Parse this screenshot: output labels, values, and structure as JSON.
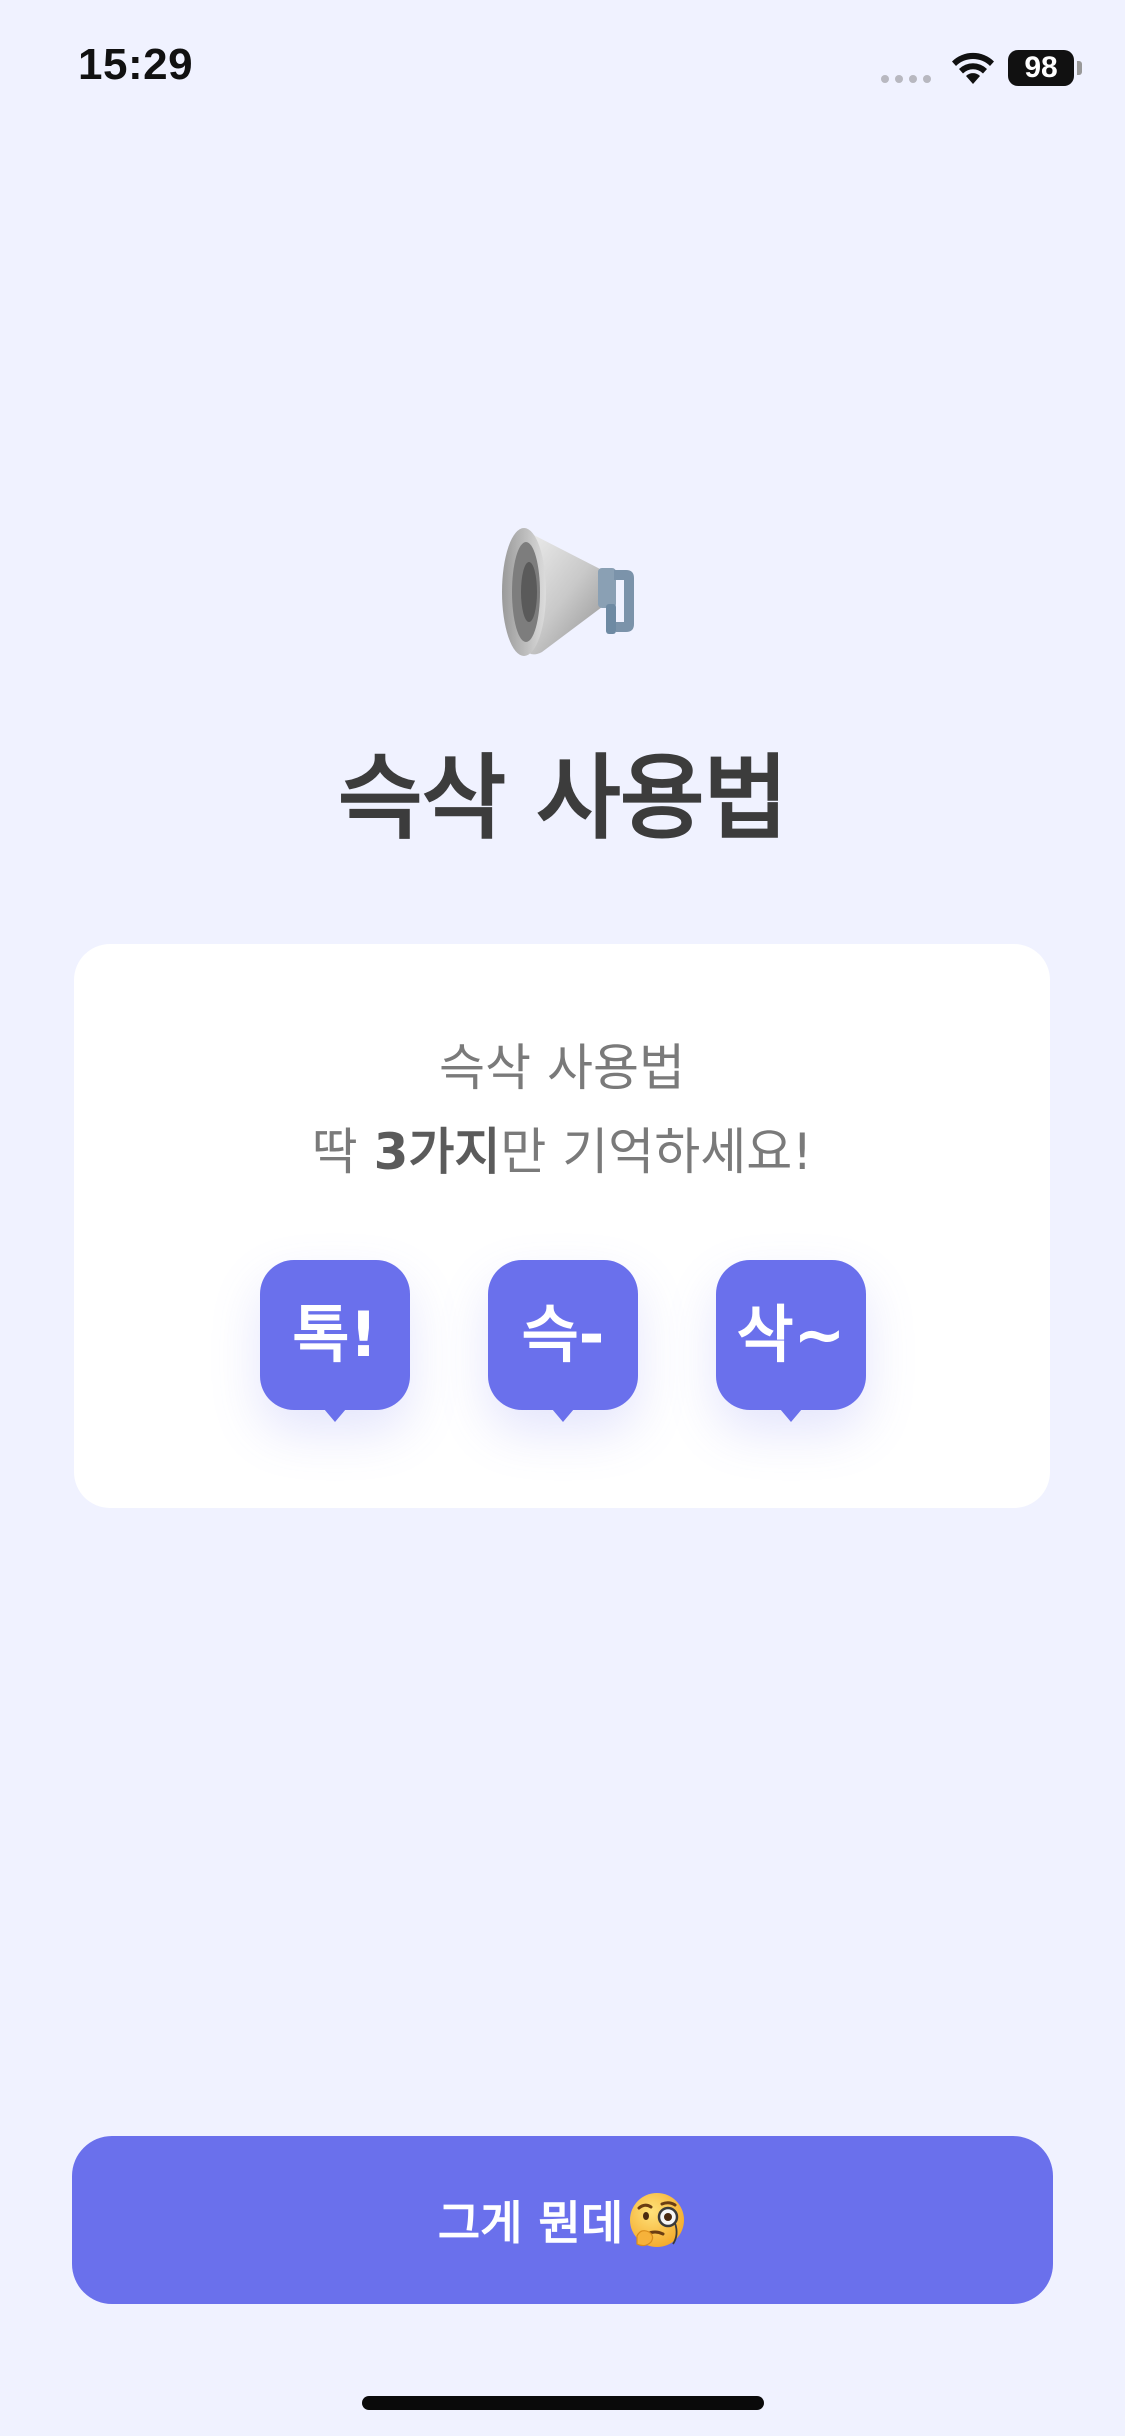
{
  "status_bar": {
    "time": "15:29",
    "battery": "98"
  },
  "hero": {
    "icon": "megaphone-icon",
    "title": "슥삭 사용법"
  },
  "card": {
    "line1": "슥삭 사용법",
    "line2_prefix": "딱 ",
    "line2_bold": "3가지",
    "line2_suffix": "만 기억하세요!",
    "bubbles": [
      "톡!",
      "슥-",
      "삭~"
    ]
  },
  "cta": {
    "label": "그게 뭔데",
    "icon": "face-with-monocle-icon"
  },
  "colors": {
    "background": "#f0f2ff",
    "accent": "#6a70ec",
    "card": "#ffffff",
    "title": "#3c3c3c"
  }
}
